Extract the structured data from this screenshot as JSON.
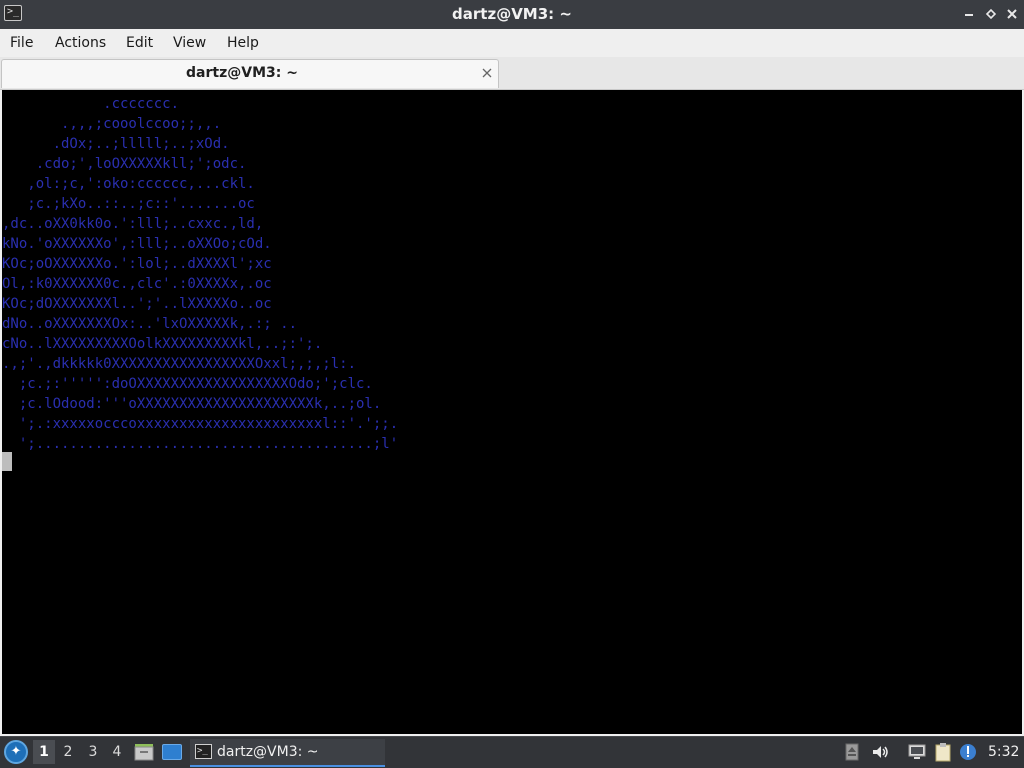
{
  "window": {
    "title": "dartz@VM3: ~"
  },
  "menubar": {
    "items": [
      "File",
      "Actions",
      "Edit",
      "View",
      "Help"
    ]
  },
  "tab": {
    "label": "dartz@VM3: ~",
    "close_icon": "close-icon"
  },
  "terminal": {
    "text_color": "#2a2fb0",
    "background": "#000000",
    "lines": [
      "            .ccccccc.",
      "       .,,,;cooolccoo;;,,.",
      "      .dOx;..;lllll;..;xOd.",
      "    .cdo;',loOXXXXXkll;';odc.",
      "   ,ol:;c,':oko:cccccc,...ckl.",
      "   ;c.;kXo..::..;c::'.......oc",
      ",dc..oXX0kk0o.':lll;..cxxc.,ld,",
      "kNo.'oXXXXXXo',:lll;..oXXOo;cOd.",
      "KOc;oOXXXXXXo.':lol;..dXXXXl';xc",
      "Ol,:k0XXXXXX0c.,clc'.:0XXXXx,.oc",
      "KOc;dOXXXXXXXl..';'..lXXXXXo..oc",
      "dNo..oXXXXXXXOx:..'lxOXXXXXk,.:; ..",
      "cNo..lXXXXXXXXXOolkXXXXXXXXXkl,..;:';.",
      ".,;'.,dkkkkk0XXXXXXXXXXXXXXXXXOxxl;,;,;l:.",
      "  ;c.;:''''':doOXXXXXXXXXXXXXXXXXXOdo;';clc.",
      "  ;c.lOdood:'''oXXXXXXXXXXXXXXXXXXXXXk,..;ol.",
      "  ';.:xxxxxocccoxxxxxxxxxxxxxxxxxxxxxxl::'.';;.",
      "  ';........................................;l'"
    ]
  },
  "taskbar": {
    "start_icon": "lxqt-start-icon",
    "desktops": [
      "1",
      "2",
      "3",
      "4"
    ],
    "active_desktop": "1",
    "launchers": [
      "file-manager-icon",
      "show-desktop-icon"
    ],
    "task_title": "dartz@VM3: ~",
    "tray_icons": [
      "eject-icon",
      "volume-icon",
      "network-icon",
      "clipboard-icon",
      "update-notifier-icon"
    ],
    "clock": "5:32"
  }
}
